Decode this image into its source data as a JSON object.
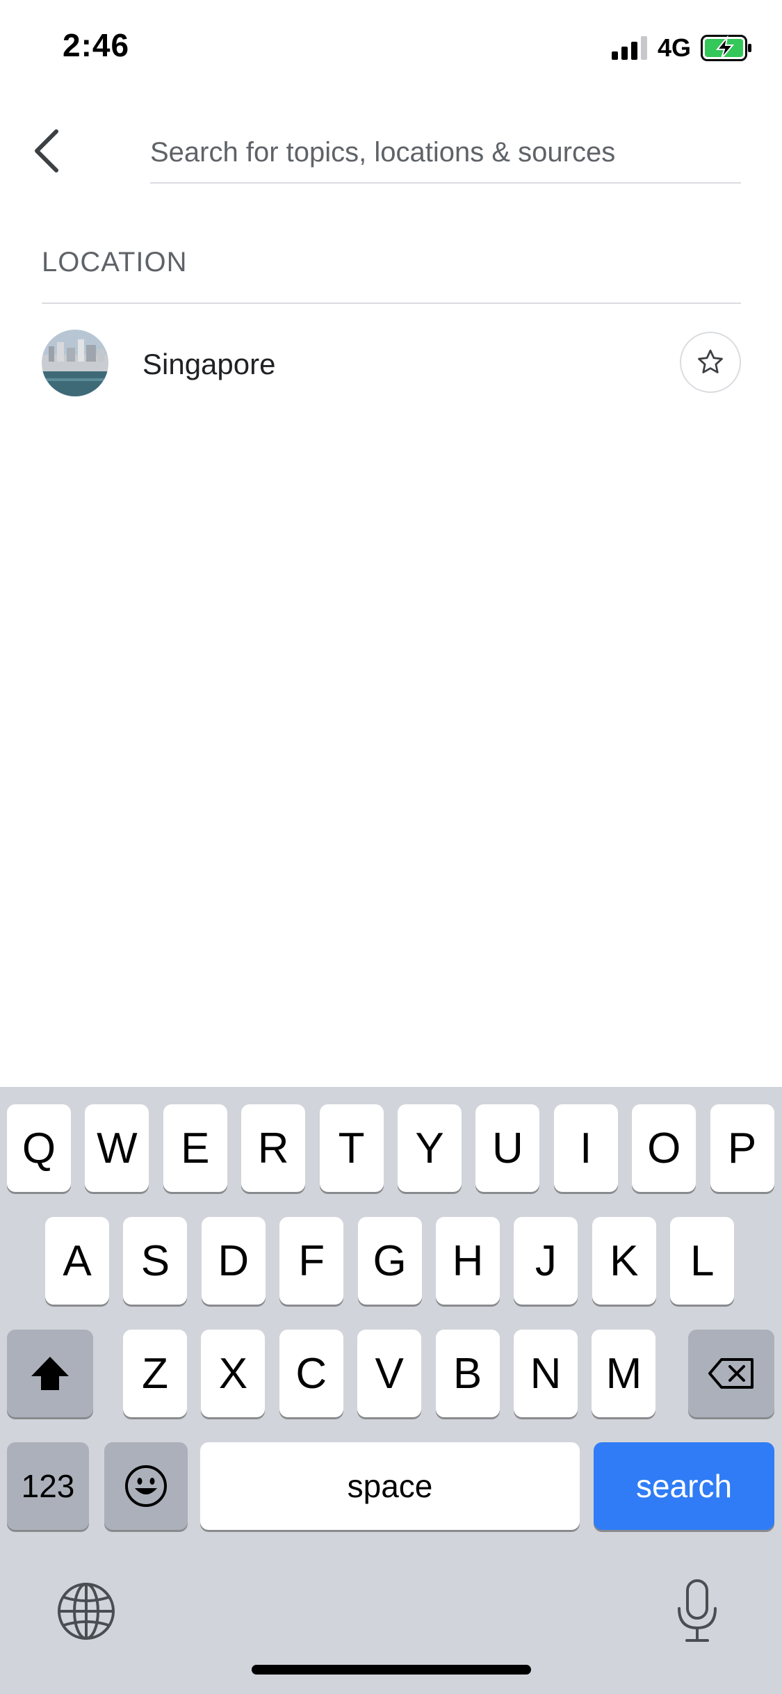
{
  "status_bar": {
    "time": "2:46",
    "network": "4G",
    "battery_color": "#34c759"
  },
  "search": {
    "placeholder": "Search for topics, locations & sources",
    "value": ""
  },
  "section": {
    "heading": "LOCATION"
  },
  "results": [
    {
      "name": "Singapore",
      "icon": "star-outline-icon"
    }
  ],
  "keyboard": {
    "row1": [
      "Q",
      "W",
      "E",
      "R",
      "T",
      "Y",
      "U",
      "I",
      "O",
      "P"
    ],
    "row2": [
      "A",
      "S",
      "D",
      "F",
      "G",
      "H",
      "J",
      "K",
      "L"
    ],
    "row3": [
      "Z",
      "X",
      "C",
      "V",
      "B",
      "N",
      "M"
    ],
    "numbers_label": "123",
    "space_label": "space",
    "action_label": "search",
    "action_color": "#2f7cf6"
  }
}
